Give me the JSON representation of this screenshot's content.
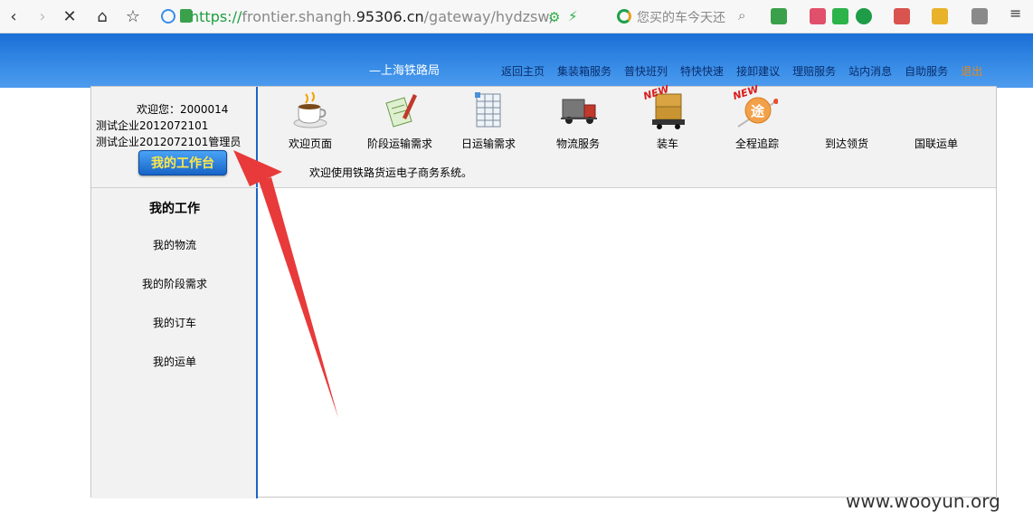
{
  "browser": {
    "url_scheme": "https://",
    "url_host_pre": "frontier.shangh.",
    "url_host": "95306.cn",
    "url_path": "/gateway/hydzsw/Dz",
    "search_placeholder": "您买的车今天还"
  },
  "banner": {
    "title": "—上海铁路局"
  },
  "topnav": [
    "返回主页",
    "集装箱服务",
    "普快班列",
    "特快快速",
    "接卸建议",
    "理赔服务",
    "站内消息",
    "自助服务",
    "退出"
  ],
  "user": {
    "welcome": "欢迎您：2000014",
    "company": "测试企业2012072101",
    "role": "测试企业2012072101管理员"
  },
  "workbench_button": "我的工作台",
  "sidebar": {
    "title": "我的工作",
    "items": [
      "我的物流",
      "我的阶段需求",
      "我的订车",
      "我的运单"
    ]
  },
  "toolbar": [
    {
      "label": "欢迎页面",
      "icon": "coffee-cup-icon"
    },
    {
      "label": "阶段运输需求",
      "icon": "document-pen-icon"
    },
    {
      "label": "日运输需求",
      "icon": "spreadsheet-icon"
    },
    {
      "label": "物流服务",
      "icon": "truck-icon"
    },
    {
      "label": "装车",
      "icon": "loading-container-icon",
      "badge": "NEW"
    },
    {
      "label": "全程追踪",
      "icon": "tracking-route-icon",
      "badge": "NEW",
      "glyph": "途"
    },
    {
      "label": "到达领货",
      "icon": ""
    },
    {
      "label": "国联运单",
      "icon": ""
    }
  ],
  "welcome_message": "欢迎使用铁路货运电子商务系统。",
  "watermark": "www.wooyun.org"
}
